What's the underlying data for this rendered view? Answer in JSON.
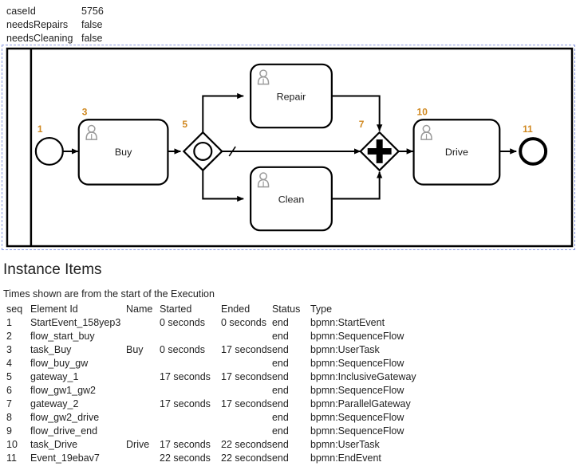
{
  "variables": [
    {
      "key": "caseId",
      "value": "5756"
    },
    {
      "key": "needsRepairs",
      "value": "false"
    },
    {
      "key": "needsCleaning",
      "value": "false"
    }
  ],
  "diagram": {
    "type": "bpmn-process",
    "nodes": [
      {
        "seq": "1",
        "id": "StartEvent_158yep3",
        "label": "",
        "kind": "start-event"
      },
      {
        "seq": "3",
        "id": "task_Buy",
        "label": "Buy",
        "kind": "user-task"
      },
      {
        "seq": "5",
        "id": "gateway_1",
        "label": "",
        "kind": "inclusive-gateway"
      },
      {
        "seq": "",
        "id": "task_Repair",
        "label": "Repair",
        "kind": "user-task"
      },
      {
        "seq": "",
        "id": "task_Clean",
        "label": "Clean",
        "kind": "user-task"
      },
      {
        "seq": "7",
        "id": "gateway_2",
        "label": "",
        "kind": "parallel-gateway"
      },
      {
        "seq": "10",
        "id": "task_Drive",
        "label": "Drive",
        "kind": "user-task"
      },
      {
        "seq": "11",
        "id": "Event_19ebav7",
        "label": "",
        "kind": "end-event"
      }
    ],
    "labels": {
      "buy": "Buy",
      "repair": "Repair",
      "clean": "Clean",
      "drive": "Drive",
      "n1": "1",
      "n3": "3",
      "n5": "5",
      "n7": "7",
      "n10": "10",
      "n11": "11"
    },
    "colors": {
      "stroke": "#000000",
      "seq_number": "#d08820",
      "label": "#1a1a1a",
      "container_border": "#8b9ae0",
      "task_icon": "#9a9a9a"
    }
  },
  "items_section": {
    "title": "Instance Items",
    "note": "Times shown are from the start of the Execution",
    "columns": [
      "seq",
      "Element Id",
      "Name",
      "Started",
      "Ended",
      "Status",
      "Type"
    ],
    "rows": [
      {
        "seq": "1",
        "element_id": "StartEvent_158yep3",
        "name": "",
        "started": "0 seconds",
        "ended": "0 seconds",
        "status": "end",
        "type": "bpmn:StartEvent"
      },
      {
        "seq": "2",
        "element_id": "flow_start_buy",
        "name": "",
        "started": "",
        "ended": "",
        "status": "end",
        "type": "bpmn:SequenceFlow"
      },
      {
        "seq": "3",
        "element_id": "task_Buy",
        "name": "Buy",
        "started": "0 seconds",
        "ended": "17 seconds",
        "status": "end",
        "type": "bpmn:UserTask"
      },
      {
        "seq": "4",
        "element_id": "flow_buy_gw",
        "name": "",
        "started": "",
        "ended": "",
        "status": "end",
        "type": "bpmn:SequenceFlow"
      },
      {
        "seq": "5",
        "element_id": "gateway_1",
        "name": "",
        "started": "17 seconds",
        "ended": "17 seconds",
        "status": "end",
        "type": "bpmn:InclusiveGateway"
      },
      {
        "seq": "6",
        "element_id": "flow_gw1_gw2",
        "name": "",
        "started": "",
        "ended": "",
        "status": "end",
        "type": "bpmn:SequenceFlow"
      },
      {
        "seq": "7",
        "element_id": "gateway_2",
        "name": "",
        "started": "17 seconds",
        "ended": "17 seconds",
        "status": "end",
        "type": "bpmn:ParallelGateway"
      },
      {
        "seq": "8",
        "element_id": "flow_gw2_drive",
        "name": "",
        "started": "",
        "ended": "",
        "status": "end",
        "type": "bpmn:SequenceFlow"
      },
      {
        "seq": "9",
        "element_id": "flow_drive_end",
        "name": "",
        "started": "",
        "ended": "",
        "status": "end",
        "type": "bpmn:SequenceFlow"
      },
      {
        "seq": "10",
        "element_id": "task_Drive",
        "name": "Drive",
        "started": "17 seconds",
        "ended": "22 seconds",
        "status": "end",
        "type": "bpmn:UserTask"
      },
      {
        "seq": "11",
        "element_id": "Event_19ebav7",
        "name": "",
        "started": "22 seconds",
        "ended": "22 seconds",
        "status": "end",
        "type": "bpmn:EndEvent"
      }
    ]
  }
}
